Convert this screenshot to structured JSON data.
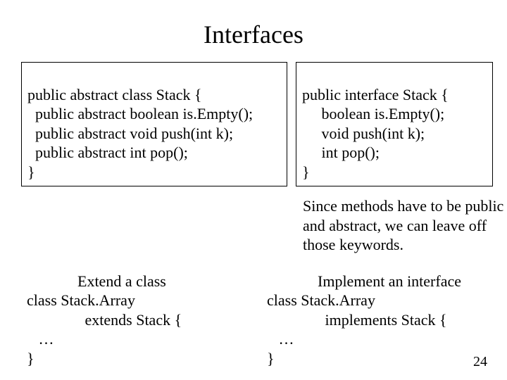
{
  "title": "Interfaces",
  "left_box": {
    "l1": "public abstract class Stack {",
    "l2": "  public abstract boolean is.Empty();",
    "l3": "  public abstract void push(int k);",
    "l4": "  public abstract int pop();",
    "l5": "}"
  },
  "right_box": {
    "l1": "public interface Stack {",
    "l2": "     boolean is.Empty();",
    "l3": "     void push(int k);",
    "l4": "     int pop();",
    "l5": "}"
  },
  "note": "Since methods have to be public and abstract, we can leave off those keywords.",
  "bottom_left": {
    "heading": "Extend a class",
    "l1": "class Stack.Array",
    "l2": "               extends Stack {",
    "l3": "   …",
    "l4": "}"
  },
  "bottom_right": {
    "heading": "Implement an interface",
    "l1": "class Stack.Array",
    "l2": "               implements Stack {",
    "l3": "   …",
    "l4": "}"
  },
  "page_number": "24"
}
